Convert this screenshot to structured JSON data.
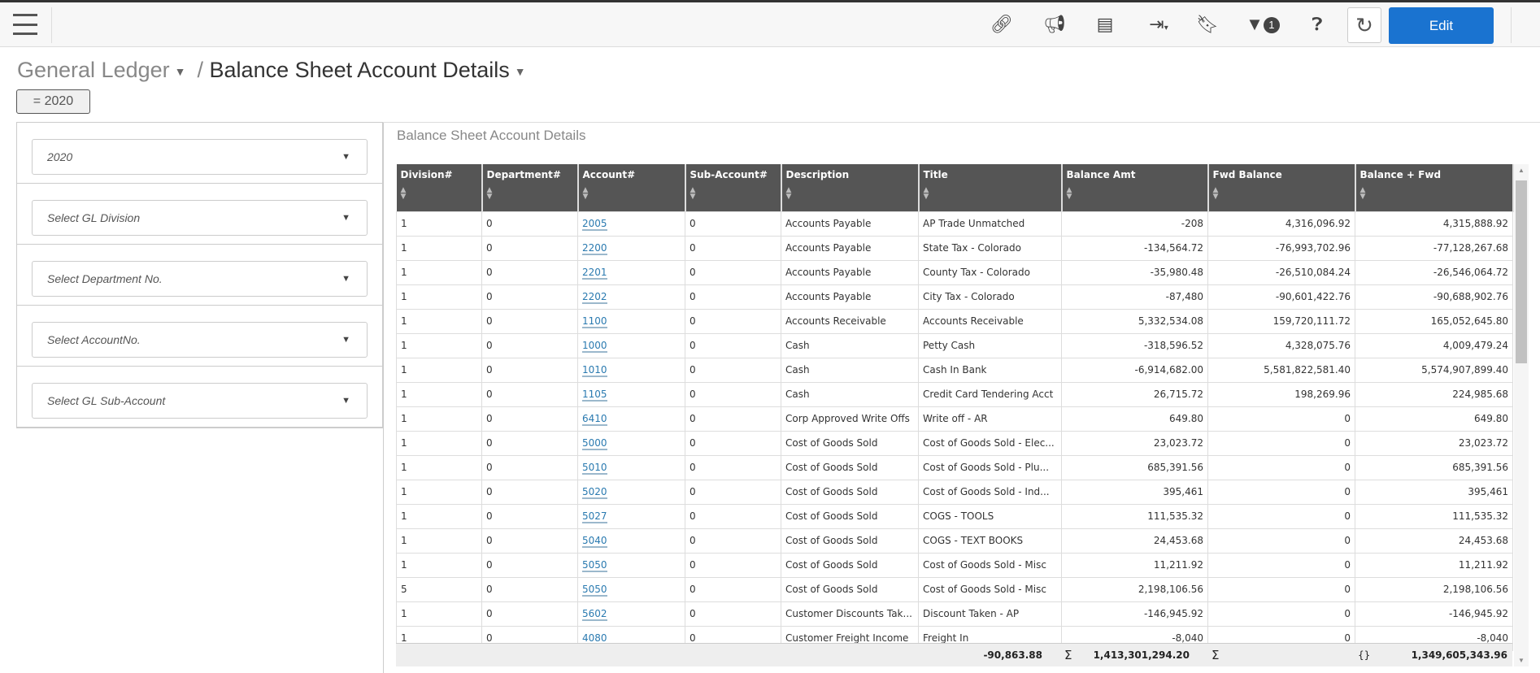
{
  "toolbar": {
    "icons": [
      "link-icon",
      "megaphone-icon",
      "document-icon",
      "export-icon",
      "bookmark-icon",
      "filter-icon",
      "help-icon",
      "refresh-icon"
    ],
    "filter_count": "1",
    "edit_label": "Edit"
  },
  "breadcrumb": {
    "parent": "General Ledger",
    "current": "Balance Sheet Account Details",
    "separator": "/"
  },
  "filter_chip": "= 2020",
  "filters": [
    {
      "value": "2020",
      "placeholder": ""
    },
    {
      "value": "",
      "placeholder": "Select GL Division"
    },
    {
      "value": "",
      "placeholder": "Select Department No."
    },
    {
      "value": "",
      "placeholder": "Select AccountNo."
    },
    {
      "value": "",
      "placeholder": "Select GL Sub-Account"
    }
  ],
  "grid": {
    "title": "Balance Sheet Account Details",
    "columns": [
      "Division#",
      "Department#",
      "Account#",
      "Sub-Account#",
      "Description",
      "Title",
      "Balance Amt",
      "Fwd Balance",
      "Balance + Fwd"
    ],
    "rows": [
      [
        "1",
        "0",
        "2005",
        "0",
        "Accounts Payable",
        "AP Trade Unmatched",
        "-208",
        "4,316,096.92",
        "4,315,888.92"
      ],
      [
        "1",
        "0",
        "2200",
        "0",
        "Accounts Payable",
        "State Tax - Colorado",
        "-134,564.72",
        "-76,993,702.96",
        "-77,128,267.68"
      ],
      [
        "1",
        "0",
        "2201",
        "0",
        "Accounts Payable",
        "County Tax - Colorado",
        "-35,980.48",
        "-26,510,084.24",
        "-26,546,064.72"
      ],
      [
        "1",
        "0",
        "2202",
        "0",
        "Accounts Payable",
        "City Tax - Colorado",
        "-87,480",
        "-90,601,422.76",
        "-90,688,902.76"
      ],
      [
        "1",
        "0",
        "1100",
        "0",
        "Accounts Receivable",
        "Accounts Receivable",
        "5,332,534.08",
        "159,720,111.72",
        "165,052,645.80"
      ],
      [
        "1",
        "0",
        "1000",
        "0",
        "Cash",
        "Petty Cash",
        "-318,596.52",
        "4,328,075.76",
        "4,009,479.24"
      ],
      [
        "1",
        "0",
        "1010",
        "0",
        "Cash",
        "Cash In Bank",
        "-6,914,682.00",
        "5,581,822,581.40",
        "5,574,907,899.40"
      ],
      [
        "1",
        "0",
        "1105",
        "0",
        "Cash",
        "Credit Card Tendering Acct",
        "26,715.72",
        "198,269.96",
        "224,985.68"
      ],
      [
        "1",
        "0",
        "6410",
        "0",
        "Corp Approved Write Offs",
        "Write off - AR",
        "649.80",
        "0",
        "649.80"
      ],
      [
        "1",
        "0",
        "5000",
        "0",
        "Cost of Goods Sold",
        "Cost of Goods Sold - Elec...",
        "23,023.72",
        "0",
        "23,023.72"
      ],
      [
        "1",
        "0",
        "5010",
        "0",
        "Cost of Goods Sold",
        "Cost of Goods Sold - Plu...",
        "685,391.56",
        "0",
        "685,391.56"
      ],
      [
        "1",
        "0",
        "5020",
        "0",
        "Cost of Goods Sold",
        "Cost of Goods Sold - Ind...",
        "395,461",
        "0",
        "395,461"
      ],
      [
        "1",
        "0",
        "5027",
        "0",
        "Cost of Goods Sold",
        "COGS - TOOLS",
        "111,535.32",
        "0",
        "111,535.32"
      ],
      [
        "1",
        "0",
        "5040",
        "0",
        "Cost of Goods Sold",
        "COGS - TEXT BOOKS",
        "24,453.68",
        "0",
        "24,453.68"
      ],
      [
        "1",
        "0",
        "5050",
        "0",
        "Cost of Goods Sold",
        "Cost of Goods Sold - Misc",
        "11,211.92",
        "0",
        "11,211.92"
      ],
      [
        "5",
        "0",
        "5050",
        "0",
        "Cost of Goods Sold",
        "Cost of Goods Sold - Misc",
        "2,198,106.56",
        "0",
        "2,198,106.56"
      ],
      [
        "1",
        "0",
        "5602",
        "0",
        "Customer Discounts Tak...",
        "Discount Taken - AP",
        "-146,945.92",
        "0",
        "-146,945.92"
      ],
      [
        "1",
        "0",
        "4080",
        "0",
        "Customer Freight Income",
        "Freight In",
        "-8,040",
        "0",
        "-8,040"
      ]
    ],
    "totals": {
      "balance_symbol": "Σ",
      "balance_amt": "-90,863.88",
      "fwd_symbol": "Σ",
      "fwd_balance": "1,413,301,294.20",
      "bf_symbol": "{}",
      "balance_fwd": "1,349,605,343.96"
    }
  }
}
